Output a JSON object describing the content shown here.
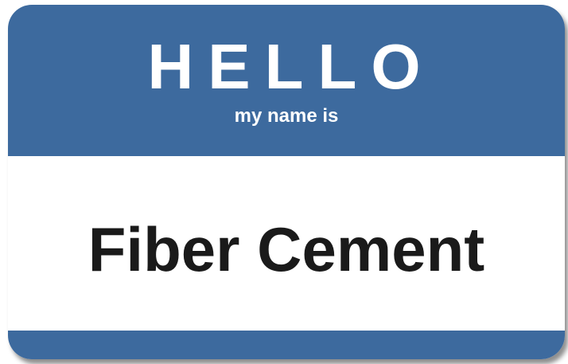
{
  "tag": {
    "greeting": "HELLO",
    "subtitle": "my name is",
    "name": "Fiber Cement",
    "band_color": "#3d6a9e",
    "text_color": "#1a1a1a"
  }
}
